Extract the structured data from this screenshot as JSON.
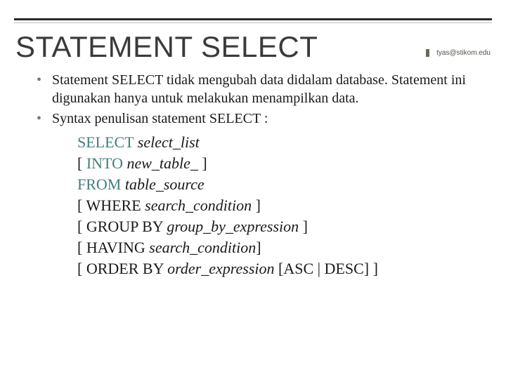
{
  "header": {
    "title": "STATEMENT SELECT",
    "email": "tyas@stikom.edu"
  },
  "bullets": [
    "Statement SELECT tidak mengubah data didalam database. Statement ini digunakan hanya untuk melakukan menampilkan data.",
    "Syntax penulisan statement SELECT :"
  ],
  "syntax": {
    "l1_kw": "SELECT ",
    "l1_ph": "select_list",
    "l2_br1": "[ ",
    "l2_kw": "INTO ",
    "l2_ph": "new_table_ ",
    "l2_br2": "]",
    "l3_kw": "FROM ",
    "l3_ph": "table_source",
    "l4_br1": "[ ",
    "l4_kw": "WHERE ",
    "l4_ph": "search_condition ",
    "l4_br2": "]",
    "l5_br1": "[ ",
    "l5_kw": "GROUP BY ",
    "l5_ph": "group_by_expression ",
    "l5_br2": "]",
    "l6_br1": "[ ",
    "l6_kw": "HAVING ",
    "l6_ph": "search_condition",
    "l6_br2": "]",
    "l7_br1": "[ ",
    "l7_kw": "ORDER BY ",
    "l7_ph": "order_expression ",
    "l7_tail": "[ASC | DESC] ]"
  }
}
